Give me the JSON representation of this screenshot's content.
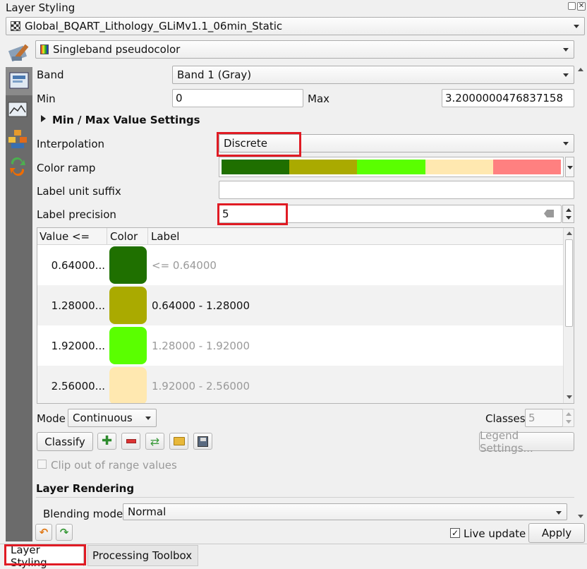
{
  "panel": {
    "title": "Layer Styling",
    "layer_name": "Global_BQART_Lithology_GLiMv1.1_06min_Static",
    "renderer": "Singleband pseudocolor"
  },
  "band": {
    "label": "Band",
    "value": "Band 1 (Gray)",
    "min_label": "Min",
    "min_value": "0",
    "max_label": "Max",
    "max_value": "3.2000000476837158"
  },
  "minmax_section": "Min / Max Value Settings",
  "interpolation": {
    "label": "Interpolation",
    "value": "Discrete"
  },
  "color_ramp": {
    "label": "Color ramp",
    "colors": [
      "#1f6f00",
      "#aaaa00",
      "#5aff00",
      "#ffe8b0",
      "#ff8080"
    ]
  },
  "label_unit_suffix": {
    "label": "Label unit suffix",
    "value": ""
  },
  "label_precision": {
    "label": "Label precision",
    "value": "5"
  },
  "table": {
    "headers": [
      "Value <=",
      "Color",
      "Label"
    ],
    "rows": [
      {
        "value": "0.64000...",
        "color": "#1f7000",
        "label": "<= 0.64000",
        "muted": true
      },
      {
        "value": "1.28000...",
        "color": "#aaaa00",
        "label": "0.64000 - 1.28000",
        "muted": false
      },
      {
        "value": "1.92000...",
        "color": "#5aff00",
        "label": "1.28000 - 1.92000",
        "muted": true
      },
      {
        "value": "2.56000...",
        "color": "#ffe8b0",
        "label": "1.92000 - 2.56000",
        "muted": true
      }
    ]
  },
  "mode": {
    "label": "Mode",
    "value": "Continuous",
    "classes_label": "Classes",
    "classes_value": "5"
  },
  "buttons": {
    "classify": "Classify",
    "legend_settings": "Legend Settings...",
    "clip_label": "Clip out of range values",
    "apply": "Apply",
    "live_update": "Live update"
  },
  "layer_rendering": {
    "title": "Layer Rendering",
    "blending_label": "Blending mode",
    "blending_value": "Normal"
  },
  "tabs": [
    "Layer Styling",
    "Processing Toolbox"
  ],
  "accent": "#e01b24"
}
